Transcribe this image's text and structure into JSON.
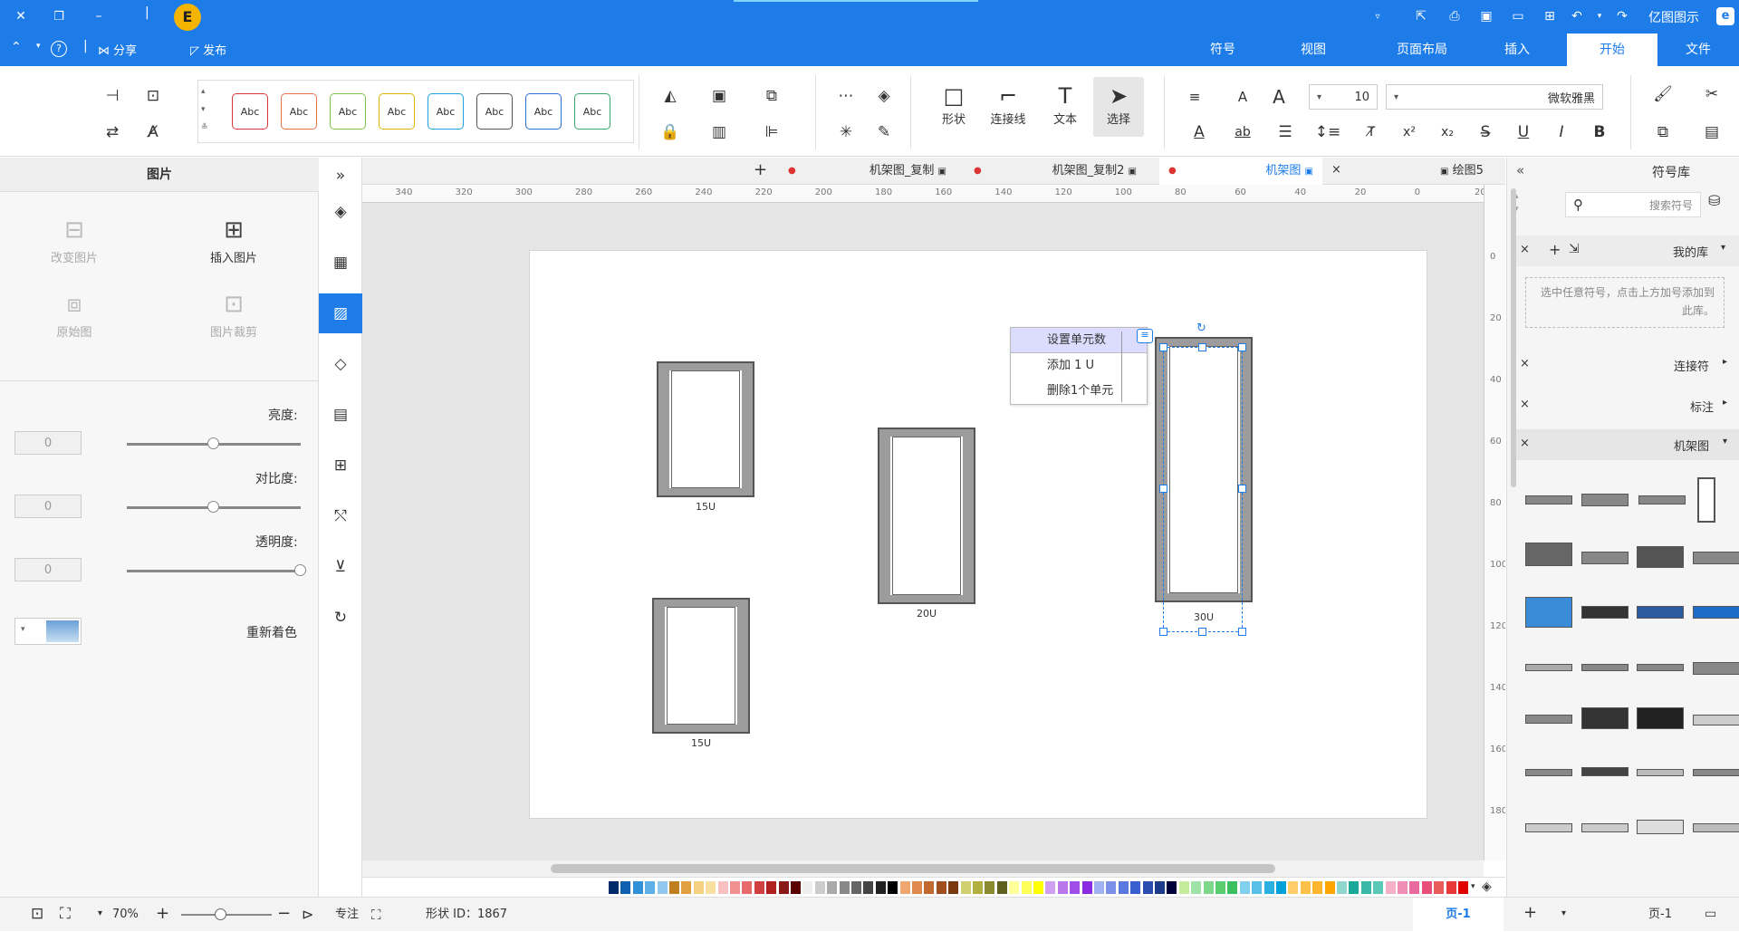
{
  "app": {
    "title": "亿图图示",
    "logo_letter": "E"
  },
  "titlebar": {
    "publish_label": "发布",
    "share_label": "分享",
    "help_glyph": "?",
    "minimize_glyph": "–",
    "maximize_glyph": "❐",
    "close_glyph": "✕"
  },
  "menu_tabs": [
    {
      "label": "文件"
    },
    {
      "label": "开始"
    },
    {
      "label": "插入"
    },
    {
      "label": "页面布局"
    },
    {
      "label": "视图"
    },
    {
      "label": "符号"
    }
  ],
  "ribbon": {
    "font_name": "微软雅黑",
    "font_size": "10",
    "select_label": "选择",
    "text_label": "文本",
    "connector_label": "连接线",
    "shape_label": "形状",
    "style_sample_text": "Abc",
    "style_colors": [
      "#3aa66a",
      "#2c6fd6",
      "#555555",
      "#1fa0e0",
      "#e0b400",
      "#7cc24a",
      "#e8744a",
      "#d83a3a"
    ]
  },
  "symbol_panel": {
    "title": "符号库",
    "search_placeholder": "搜索符号",
    "my_library": "我的库",
    "my_library_hint": "选中任意符号，点击上方加号添加到此库。",
    "categories": [
      {
        "label": "连接符"
      },
      {
        "label": "标注"
      },
      {
        "label": "机架图"
      }
    ]
  },
  "doc_tabs": [
    {
      "label": "绘图5"
    },
    {
      "label": "机架图"
    },
    {
      "label": "机架图_复制2"
    },
    {
      "label": "机架图_复制"
    }
  ],
  "hruler_labels": [
    "20",
    "0",
    "20",
    "40",
    "60",
    "80",
    "100",
    "120",
    "140",
    "160",
    "180",
    "200",
    "220",
    "240",
    "260",
    "280",
    "300",
    "320",
    "340"
  ],
  "vruler_labels": [
    "0",
    "20",
    "40",
    "60",
    "80",
    "100",
    "120",
    "140",
    "160",
    "180"
  ],
  "racks": [
    {
      "label": "15U"
    },
    {
      "label": "20U"
    },
    {
      "label": "30U"
    },
    {
      "label": "15U"
    }
  ],
  "context_menu": {
    "items": [
      {
        "label": "设置单元数"
      },
      {
        "label": "添加 1 U"
      },
      {
        "label": "删除1个单元"
      }
    ]
  },
  "image_panel": {
    "title": "图片",
    "insert_image": "插入图片",
    "change_image": "改变图片",
    "crop_image": "图片裁剪",
    "original_image": "原始图",
    "brightness_label": "亮度:",
    "contrast_label": "对比度:",
    "transparency_label": "透明度:",
    "brightness_value": "0",
    "contrast_value": "0",
    "transparency_value": "0",
    "brightness_level": 0.5,
    "contrast_level": 0.5,
    "transparency_level": 1.0,
    "recolor_label": "重新着色"
  },
  "palette_colors": [
    "#e00000",
    "#e8383a",
    "#e85c5c",
    "#e8507a",
    "#e86aa0",
    "#ef8fb8",
    "#f6b0c8",
    "#5bc8b8",
    "#3ab8a8",
    "#1aa898",
    "#8fd6cf",
    "#ffa500",
    "#ffb52e",
    "#ffc14a",
    "#ffce6a",
    "#00a0d8",
    "#2cb0e0",
    "#58c0e8",
    "#80d0ee",
    "#3ac060",
    "#5acc70",
    "#7ed88a",
    "#a0e3a6",
    "#c4ec9a",
    "#00003a",
    "#1e3a8a",
    "#2c4db0",
    "#3a60d0",
    "#5a78e0",
    "#7a90e8",
    "#a0b0f0",
    "#8a2be2",
    "#a050e8",
    "#b878ec",
    "#d0a0f0",
    "#ffff00",
    "#ffff5a",
    "#ffff9a",
    "#606020",
    "#8a8a30",
    "#b0b040",
    "#d0d070",
    "#7a3a10",
    "#a05020",
    "#c06a30",
    "#e08a50",
    "#f0a870",
    "#000000",
    "#222222",
    "#444444",
    "#666666",
    "#888888",
    "#aaaaaa",
    "#cccccc",
    "#eeeeee",
    "#5a0000",
    "#8a1a1a",
    "#b02020",
    "#d04040",
    "#e86a6a",
    "#f09090",
    "#f8c0c0",
    "#fae0a0",
    "#f5d080",
    "#e0a040",
    "#c08020",
    "#90c8f0",
    "#60b0e8",
    "#3090d8",
    "#1060b0",
    "#002a6a"
  ],
  "statusbar": {
    "page_label": "页-1",
    "page_tab": "页-1",
    "add_page_glyph": "+",
    "shape_id": "形状 ID：1867",
    "focus_label": "专注",
    "zoom": "70%",
    "zoom_level": 0.44
  }
}
